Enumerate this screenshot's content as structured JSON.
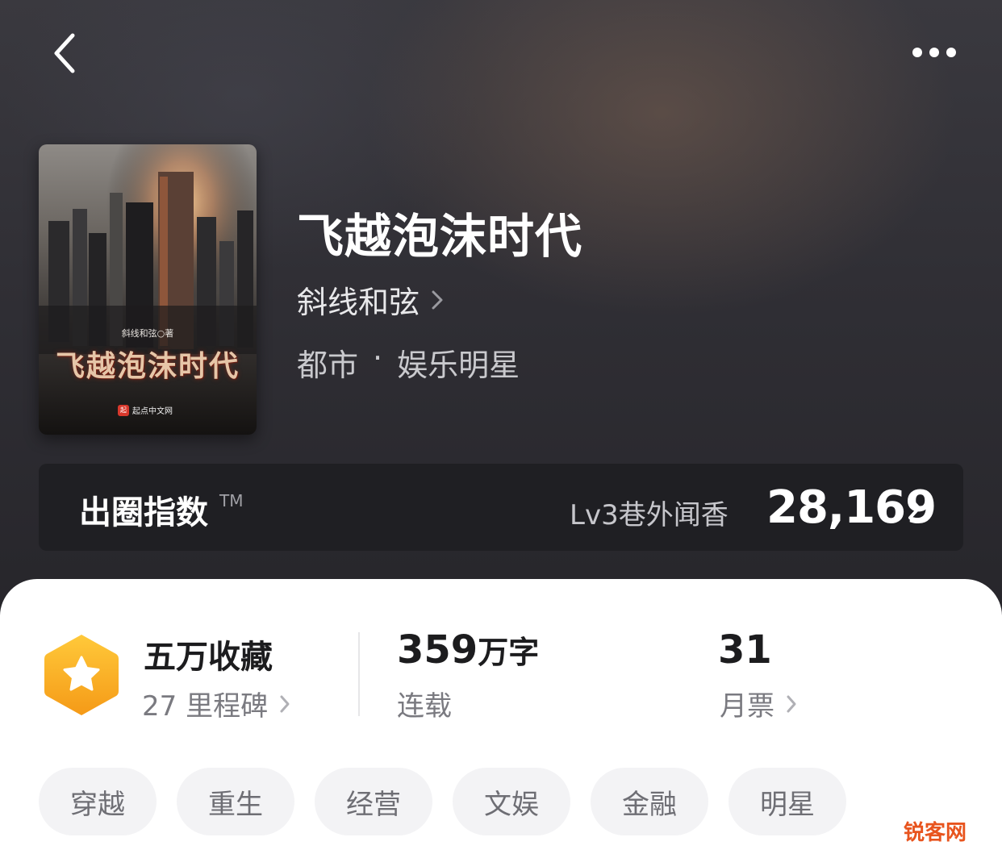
{
  "header": {
    "back_icon": "chevron-left-icon",
    "more_icon": "more-dots-icon"
  },
  "book": {
    "cover": {
      "author_line": "斜线和弦○著",
      "title": "飞越泡沫时代",
      "publisher": "起点中文网",
      "publisher_logo": "起"
    },
    "title": "飞越泡沫时代",
    "author": "斜线和弦",
    "genre_primary": "都市",
    "genre_separator": "·",
    "genre_secondary": "娱乐明星"
  },
  "index": {
    "label": "出圈指数",
    "tm": "TM",
    "level": "Lv3巷外闻香",
    "value": "28,169"
  },
  "stats": {
    "collection": {
      "main": "五万收藏",
      "sub": "27 里程碑",
      "icon": "star-hexagon-badge-icon",
      "badge_color": "#f7a51c"
    },
    "words": {
      "number": "359",
      "unit": "万字",
      "sub": "连载"
    },
    "tickets": {
      "number": "31",
      "sub": "月票"
    }
  },
  "tags": [
    "穿越",
    "重生",
    "经营",
    "文娱",
    "金融",
    "明星"
  ],
  "watermark": "锐客网"
}
